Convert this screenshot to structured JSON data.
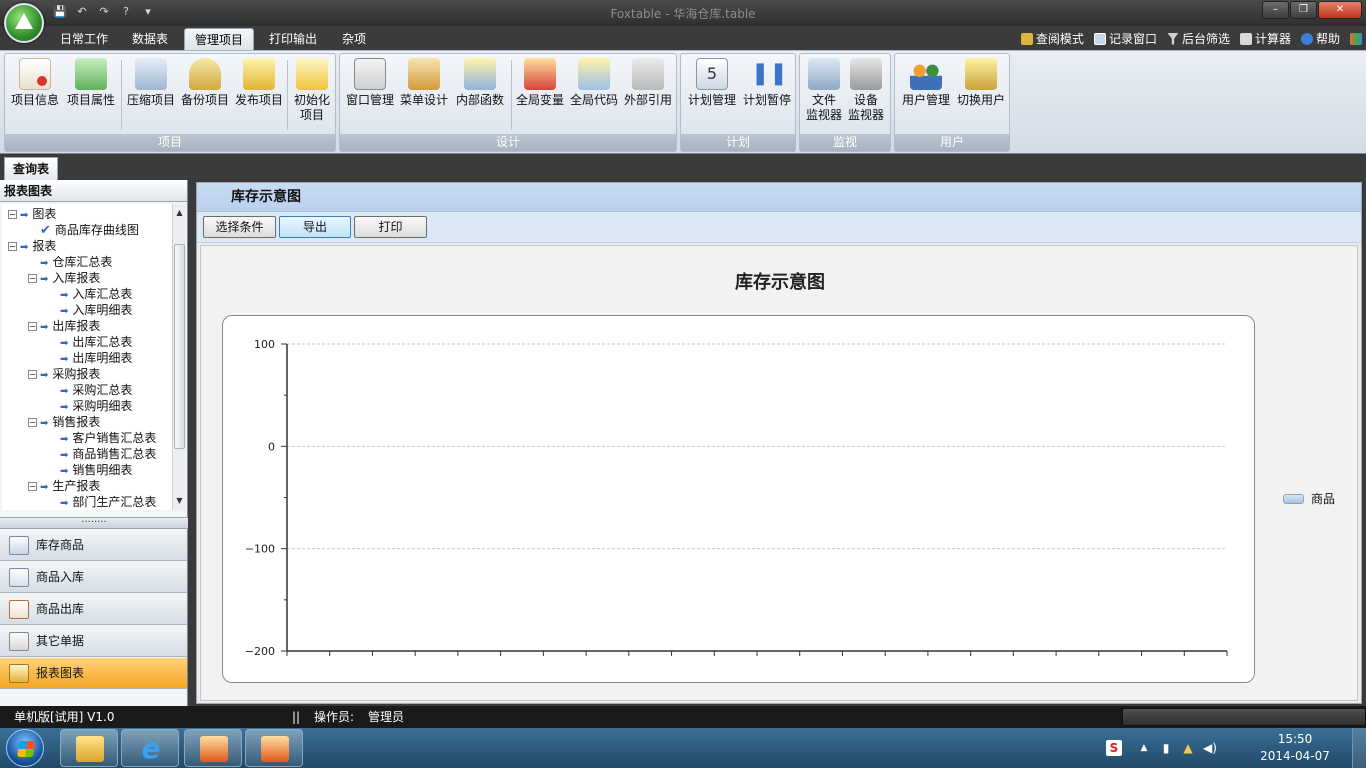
{
  "window": {
    "title": "Foxtable - 华海仓库.table",
    "controls": [
      "–",
      "❐",
      "✕"
    ]
  },
  "ribbon_tabs": [
    "日常工作",
    "数据表",
    "管理项目",
    "打印输出",
    "杂项"
  ],
  "active_tab": "管理项目",
  "right_tools": [
    {
      "label": "查阅模式",
      "icon": "lock-icon"
    },
    {
      "label": "记录窗口",
      "icon": "window-icon"
    },
    {
      "label": "后台筛选",
      "icon": "filter-icon"
    },
    {
      "label": "计算器",
      "icon": "calculator-icon"
    },
    {
      "label": "帮助",
      "icon": "help-icon"
    }
  ],
  "ribbon_groups": {
    "project": {
      "label": "项目",
      "buttons": [
        "项目信息",
        "项目属性",
        "压缩项目",
        "备份项目",
        "发布项目",
        "初始化\n项目"
      ]
    },
    "design": {
      "label": "设计",
      "buttons": [
        "窗口管理",
        "菜单设计",
        "内部函数",
        "全局变量",
        "全局代码",
        "外部引用"
      ]
    },
    "plan": {
      "label": "计划",
      "buttons": [
        "计划管理",
        "计划暂停"
      ]
    },
    "monitor": {
      "label": "监视",
      "buttons": [
        "文件\n监视器",
        "设备\n监视器"
      ]
    },
    "user": {
      "label": "用户",
      "buttons": [
        "用户管理",
        "切换用户"
      ]
    }
  },
  "doc_tab": "查询表",
  "left_panel": {
    "header": "报表图表",
    "tree": [
      {
        "label": "图表",
        "level": 0,
        "kind": "folder"
      },
      {
        "label": "商品库存曲线图",
        "level": 1,
        "kind": "check"
      },
      {
        "label": "报表",
        "level": 0,
        "kind": "folder"
      },
      {
        "label": "仓库汇总表",
        "level": 1,
        "kind": "leaf"
      },
      {
        "label": "入库报表",
        "level": 1,
        "kind": "folder"
      },
      {
        "label": "入库汇总表",
        "level": 2,
        "kind": "leaf"
      },
      {
        "label": "入库明细表",
        "level": 2,
        "kind": "leaf"
      },
      {
        "label": "出库报表",
        "level": 1,
        "kind": "folder"
      },
      {
        "label": "出库汇总表",
        "level": 2,
        "kind": "leaf"
      },
      {
        "label": "出库明细表",
        "level": 2,
        "kind": "leaf"
      },
      {
        "label": "采购报表",
        "level": 1,
        "kind": "folder"
      },
      {
        "label": "采购汇总表",
        "level": 2,
        "kind": "leaf"
      },
      {
        "label": "采购明细表",
        "level": 2,
        "kind": "leaf"
      },
      {
        "label": "销售报表",
        "level": 1,
        "kind": "folder"
      },
      {
        "label": "客户销售汇总表",
        "level": 2,
        "kind": "leaf"
      },
      {
        "label": "商品销售汇总表",
        "level": 2,
        "kind": "leaf"
      },
      {
        "label": "销售明细表",
        "level": 2,
        "kind": "leaf"
      },
      {
        "label": "生产报表",
        "level": 1,
        "kind": "folder"
      },
      {
        "label": "部门生产汇总表",
        "level": 2,
        "kind": "leaf"
      }
    ],
    "splitter": "········",
    "nav": [
      {
        "label": "库存商品",
        "icon": "calendar-grid-icon",
        "active": false
      },
      {
        "label": "商品入库",
        "icon": "contact-card-icon",
        "active": false
      },
      {
        "label": "商品出库",
        "icon": "checklist-icon",
        "active": false
      },
      {
        "label": "其它单据",
        "icon": "form-icon",
        "active": false
      },
      {
        "label": "报表图表",
        "icon": "folder-report-icon",
        "active": true
      }
    ]
  },
  "main": {
    "title": "库存示意图",
    "toolbar": [
      "选择条件",
      "导出",
      "打印"
    ]
  },
  "chart_data": {
    "type": "line",
    "title": "库存示意图",
    "xlabel": "",
    "ylabel": "",
    "ylim": [
      -200,
      100
    ],
    "yticks": [
      100,
      0,
      -100,
      -200
    ],
    "x_tick_count": 23,
    "grid": true,
    "legend_position": "right",
    "series": [
      {
        "name": "商品",
        "values": []
      }
    ]
  },
  "statusbar": {
    "edition": "单机版[试用] V1.0",
    "sep": "||",
    "operator_label": "操作员:",
    "operator": "管理员"
  },
  "taskbar": {
    "time": "15:50",
    "date": "2014-04-07"
  }
}
